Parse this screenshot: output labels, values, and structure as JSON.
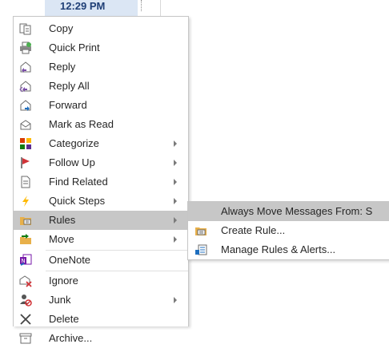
{
  "background": {
    "time": "12:29 PM"
  },
  "menu": {
    "items": [
      {
        "id": "copy",
        "label": "Copy",
        "icon": "copy-icon"
      },
      {
        "id": "quick-print",
        "label": "Quick Print",
        "icon": "printer-icon"
      },
      {
        "id": "reply",
        "label": "Reply",
        "icon": "reply-icon"
      },
      {
        "id": "reply-all",
        "label": "Reply All",
        "icon": "reply-all-icon"
      },
      {
        "id": "forward",
        "label": "Forward",
        "icon": "forward-icon"
      },
      {
        "id": "mark-as-read",
        "label": "Mark as Read",
        "icon": "envelope-open-icon"
      },
      {
        "id": "categorize",
        "label": "Categorize",
        "icon": "category-grid-icon",
        "submenu": true
      },
      {
        "id": "follow-up",
        "label": "Follow Up",
        "icon": "flag-icon",
        "submenu": true
      },
      {
        "id": "find-related",
        "label": "Find Related",
        "icon": "document-icon",
        "submenu": true
      },
      {
        "id": "quick-steps",
        "label": "Quick Steps",
        "icon": "lightning-icon",
        "submenu": true
      },
      {
        "id": "rules",
        "label": "Rules",
        "icon": "rules-folder-icon",
        "submenu": true,
        "highlighted": true
      },
      {
        "id": "move",
        "label": "Move",
        "icon": "move-folder-icon",
        "submenu": true
      },
      {
        "id": "onenote",
        "label": "OneNote",
        "icon": "onenote-icon"
      },
      {
        "id": "ignore",
        "label": "Ignore",
        "icon": "ignore-icon"
      },
      {
        "id": "junk",
        "label": "Junk",
        "icon": "junk-icon",
        "submenu": true
      },
      {
        "id": "delete",
        "label": "Delete",
        "icon": "delete-x-icon"
      },
      {
        "id": "archive",
        "label": "Archive...",
        "icon": "archive-box-icon"
      }
    ]
  },
  "submenu": {
    "items": [
      {
        "id": "always-move",
        "label": "Always Move Messages From: S",
        "highlighted": true
      },
      {
        "id": "create-rule",
        "label": "Create Rule...",
        "icon": "create-rule-icon"
      },
      {
        "id": "manage-rules",
        "label": "Manage Rules & Alerts...",
        "icon": "manage-rules-icon"
      }
    ]
  },
  "colors": {
    "hover": "#c7c7c7",
    "time_bg": "#dbe6f4",
    "text": "#262626"
  }
}
